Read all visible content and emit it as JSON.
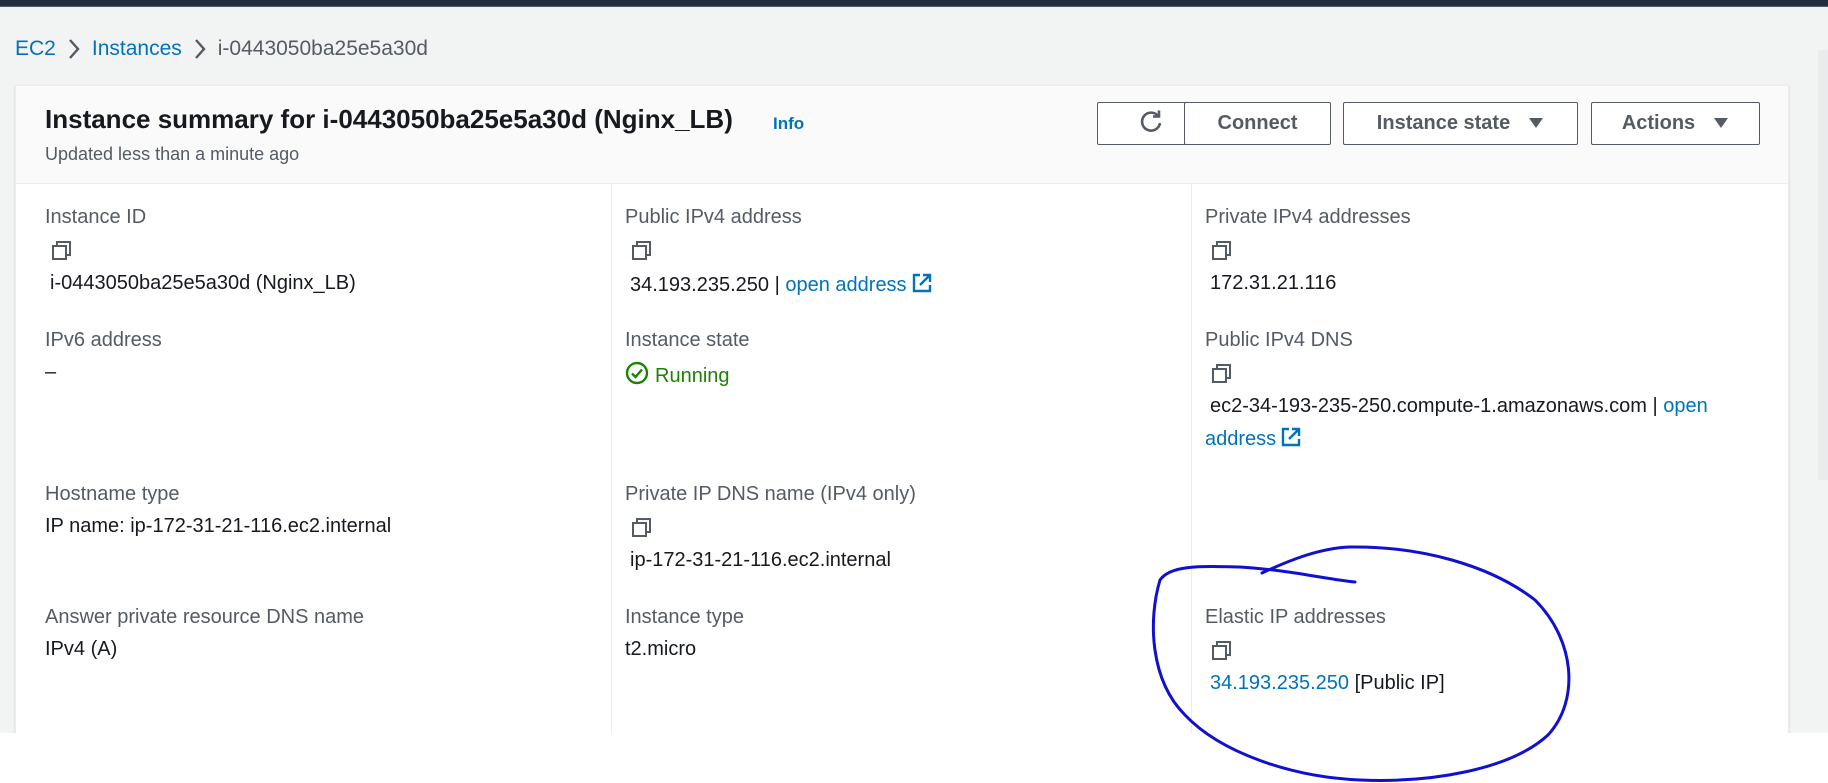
{
  "breadcrumb": {
    "root": "EC2",
    "parent": "Instances",
    "current": "i-0443050ba25e5a30d"
  },
  "header": {
    "title": "Instance summary for i-0443050ba25e5a30d (Nginx_LB)",
    "info": "Info",
    "subtitle": "Updated less than a minute ago",
    "buttons": {
      "refresh_icon": "refresh-icon",
      "connect": "Connect",
      "instance_state": "Instance state",
      "actions": "Actions"
    }
  },
  "details": {
    "instance_id": {
      "label": "Instance ID",
      "value": "i-0443050ba25e5a30d (Nginx_LB)"
    },
    "public_ipv4": {
      "label": "Public IPv4 address",
      "value": "34.193.235.250",
      "separator": "|",
      "link": "open address"
    },
    "private_ipv4": {
      "label": "Private IPv4 addresses",
      "value": "172.31.21.116"
    },
    "ipv6": {
      "label": "IPv6 address",
      "value": "–"
    },
    "instance_state": {
      "label": "Instance state",
      "value": "Running"
    },
    "public_dns": {
      "label": "Public IPv4 DNS",
      "value": "ec2-34-193-235-250.compute-1.amazonaws.com",
      "separator": "|",
      "link_part1": "open",
      "link_part2": "address"
    },
    "hostname_type": {
      "label": "Hostname type",
      "value": "IP name: ip-172-31-21-116.ec2.internal"
    },
    "private_dns": {
      "label": "Private IP DNS name (IPv4 only)",
      "value": "ip-172-31-21-116.ec2.internal"
    },
    "answer_dns": {
      "label": "Answer private resource DNS name",
      "value": "IPv4 (A)"
    },
    "instance_type": {
      "label": "Instance type",
      "value": "t2.micro"
    },
    "elastic_ip": {
      "label": "Elastic IP addresses",
      "link": "34.193.235.250",
      "suffix": "[Public IP]"
    }
  },
  "colors": {
    "link": "#0073bb",
    "running": "#1d8102",
    "annotation": "#1010d0"
  }
}
